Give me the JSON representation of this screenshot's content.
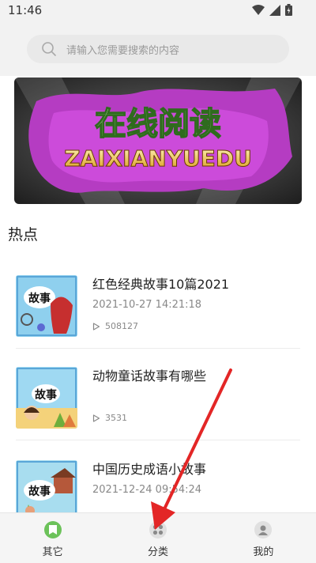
{
  "status_bar": {
    "time": "11:46"
  },
  "search": {
    "placeholder": "请输入您需要搜索的内容"
  },
  "banner": {
    "title_cn": "在线阅读",
    "title_en": "ZAIXIANYUEDU"
  },
  "section": {
    "hot_title": "热点"
  },
  "articles": [
    {
      "title": "红色经典故事10篇2021",
      "date": "2021-10-27 14:21:18",
      "views": "508127",
      "thumb_label": "故事"
    },
    {
      "title": "动物童话故事有哪些",
      "date": "",
      "views": "3531",
      "thumb_label": "故事"
    },
    {
      "title": "中国历史成语小故事",
      "date": "2021-12-24 09:54:24",
      "views": "",
      "thumb_label": "故事"
    }
  ],
  "tabs": [
    {
      "label": "其它",
      "icon": "bookmark-icon",
      "color": "#6cc25a"
    },
    {
      "label": "分类",
      "icon": "grid-icon",
      "color": "#9e9e9e"
    },
    {
      "label": "我的",
      "icon": "user-icon",
      "color": "#9e9e9e"
    }
  ],
  "colors": {
    "accent": "#6cc25a",
    "annotation_arrow": "#e32626"
  }
}
